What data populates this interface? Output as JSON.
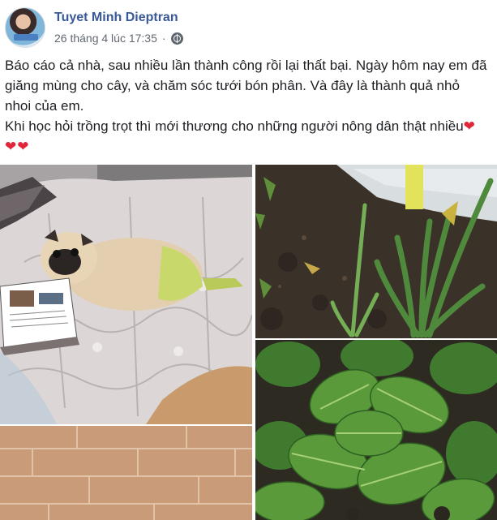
{
  "post": {
    "author": "Tuyet Minh Dieptran",
    "date": "26 tháng 4 lúc 17:35",
    "separator": "·",
    "privacy_icon": "globe-icon",
    "caption_lines": [
      "Báo cáo cả nhà, sau nhiều lần thành công rồi lại thất bại. Ngày hôm nay em đã",
      "giăng mùng cho cây, và chăm sóc tưới bón phân. Và đây là thành quả nhỏ",
      "nhoi của em.",
      "Khi học hỏi trồng trọt thì mới thương cho những người nông dân thật nhiều"
    ],
    "hearts_inline": "❤",
    "hearts_line": "❤❤"
  },
  "colors": {
    "author_link": "#385898",
    "meta_text": "#616770",
    "heart": "#e02638"
  }
}
